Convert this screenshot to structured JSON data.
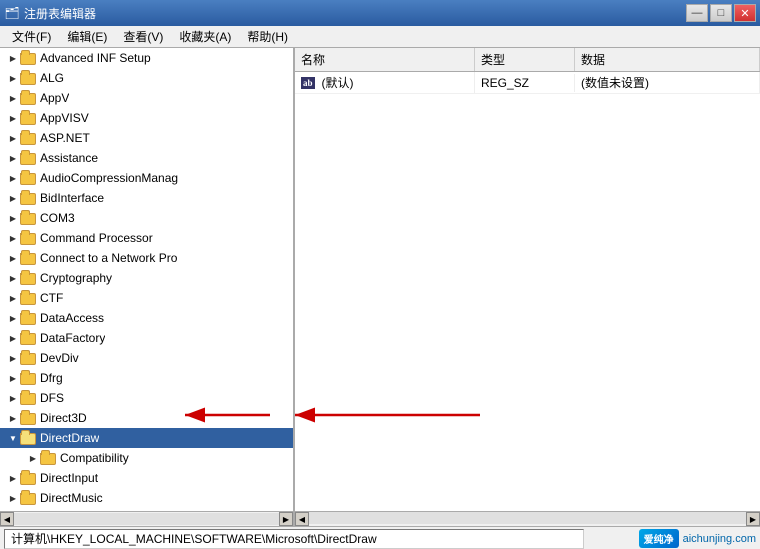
{
  "window": {
    "title": "注册表编辑器",
    "icon": "🗂"
  },
  "menu": {
    "items": [
      "文件(F)",
      "编辑(E)",
      "查看(V)",
      "收藏夹(A)",
      "帮助(H)"
    ]
  },
  "tree": {
    "items": [
      {
        "id": "advanced-inf",
        "label": "Advanced INF Setup",
        "level": 2,
        "expanded": false,
        "selected": false
      },
      {
        "id": "alg",
        "label": "ALG",
        "level": 2,
        "expanded": false,
        "selected": false
      },
      {
        "id": "appv",
        "label": "AppV",
        "level": 2,
        "expanded": false,
        "selected": false
      },
      {
        "id": "appvisv",
        "label": "AppVISV",
        "level": 2,
        "expanded": false,
        "selected": false
      },
      {
        "id": "aspnet",
        "label": "ASP.NET",
        "level": 2,
        "expanded": false,
        "selected": false
      },
      {
        "id": "assistance",
        "label": "Assistance",
        "level": 2,
        "expanded": false,
        "selected": false
      },
      {
        "id": "audiocomp",
        "label": "AudioCompressionManag",
        "level": 2,
        "expanded": false,
        "selected": false
      },
      {
        "id": "bidinterface",
        "label": "BidInterface",
        "level": 2,
        "expanded": false,
        "selected": false
      },
      {
        "id": "com3",
        "label": "COM3",
        "level": 2,
        "expanded": false,
        "selected": false
      },
      {
        "id": "cmdprocessor",
        "label": "Command Processor",
        "level": 2,
        "expanded": false,
        "selected": false
      },
      {
        "id": "connectnetwork",
        "label": "Connect to a Network Pro",
        "level": 2,
        "expanded": false,
        "selected": false
      },
      {
        "id": "cryptography",
        "label": "Cryptography",
        "level": 2,
        "expanded": false,
        "selected": false
      },
      {
        "id": "ctf",
        "label": "CTF",
        "level": 2,
        "expanded": false,
        "selected": false
      },
      {
        "id": "dataaccess",
        "label": "DataAccess",
        "level": 2,
        "expanded": false,
        "selected": false
      },
      {
        "id": "datafactory",
        "label": "DataFactory",
        "level": 2,
        "expanded": false,
        "selected": false
      },
      {
        "id": "devdiv",
        "label": "DevDiv",
        "level": 2,
        "expanded": false,
        "selected": false
      },
      {
        "id": "dfrg",
        "label": "Dfrg",
        "level": 2,
        "expanded": false,
        "selected": false
      },
      {
        "id": "dfs",
        "label": "DFS",
        "level": 2,
        "expanded": false,
        "selected": false
      },
      {
        "id": "direct3d",
        "label": "Direct3D",
        "level": 2,
        "expanded": false,
        "selected": false
      },
      {
        "id": "directdraw",
        "label": "DirectDraw",
        "level": 2,
        "expanded": true,
        "selected": true
      },
      {
        "id": "compatibility",
        "label": "Compatibility",
        "level": 3,
        "expanded": false,
        "selected": false
      },
      {
        "id": "directinput",
        "label": "DirectInput",
        "level": 2,
        "expanded": false,
        "selected": false
      },
      {
        "id": "directmusic",
        "label": "DirectMusic",
        "level": 2,
        "expanded": false,
        "selected": false
      }
    ]
  },
  "registry": {
    "columns": [
      "名称",
      "类型",
      "数据"
    ],
    "rows": [
      {
        "name": "(默认)",
        "type": "REG_SZ",
        "data": "(数值未设置)",
        "icon": "ab"
      }
    ]
  },
  "status": {
    "path": "计算机\\HKEY_LOCAL_MACHINE\\SOFTWARE\\Microsoft\\DirectDraw"
  },
  "title_buttons": {
    "minimize": "—",
    "restore": "□",
    "close": "✕"
  }
}
